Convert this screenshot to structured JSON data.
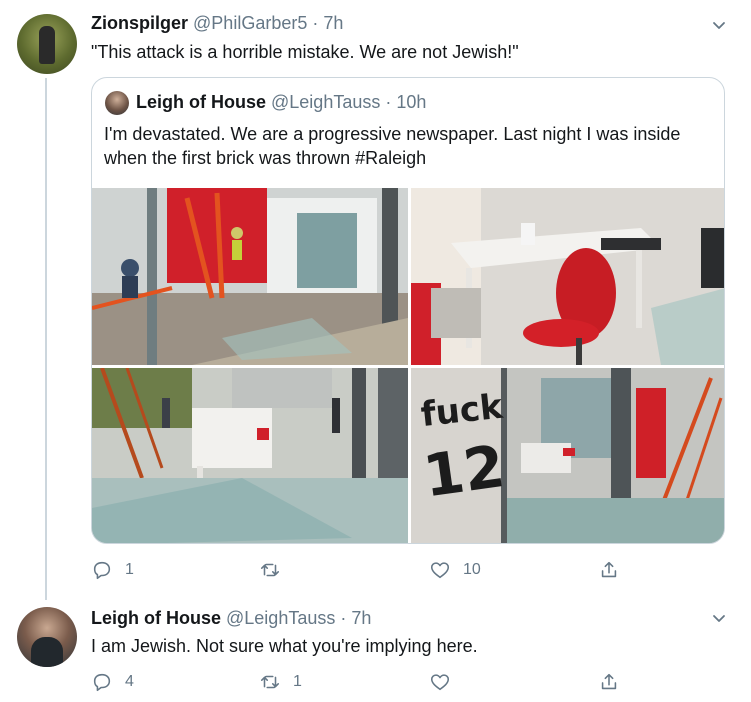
{
  "tweets": [
    {
      "author": {
        "name": "Zionspilger",
        "handle": "@PhilGarber5"
      },
      "separator": "·",
      "time": "7h",
      "text": "\"This attack is a horrible mistake. We are not Jewish!\"",
      "quoted": {
        "author": {
          "name": "Leigh of House",
          "handle": "@LeighTauss"
        },
        "separator": "·",
        "time": "10h",
        "text_line1": "I'm devastated. We are a progressive newspaper. Last night I was inside",
        "text_line2": "when the first brick was thrown #Raleigh"
      },
      "actions": {
        "reply_count": "1",
        "retweet_count": "",
        "like_count": "10"
      }
    },
    {
      "author": {
        "name": "Leigh of House",
        "handle": "@LeighTauss"
      },
      "separator": "·",
      "time": "7h",
      "text": "I am Jewish. Not sure what you're implying here.",
      "actions": {
        "reply_count": "4",
        "retweet_count": "1",
        "like_count": ""
      }
    }
  ],
  "photo_texts": {
    "graffiti_1": "fuck",
    "graffiti_2": "12"
  },
  "colors": {
    "text": "#14171a",
    "secondary": "#657786",
    "border": "#ccd6dd",
    "accent_red": "#d0202a"
  },
  "icons": [
    "chevron-down-icon",
    "reply-icon",
    "retweet-icon",
    "like-icon",
    "share-icon"
  ]
}
